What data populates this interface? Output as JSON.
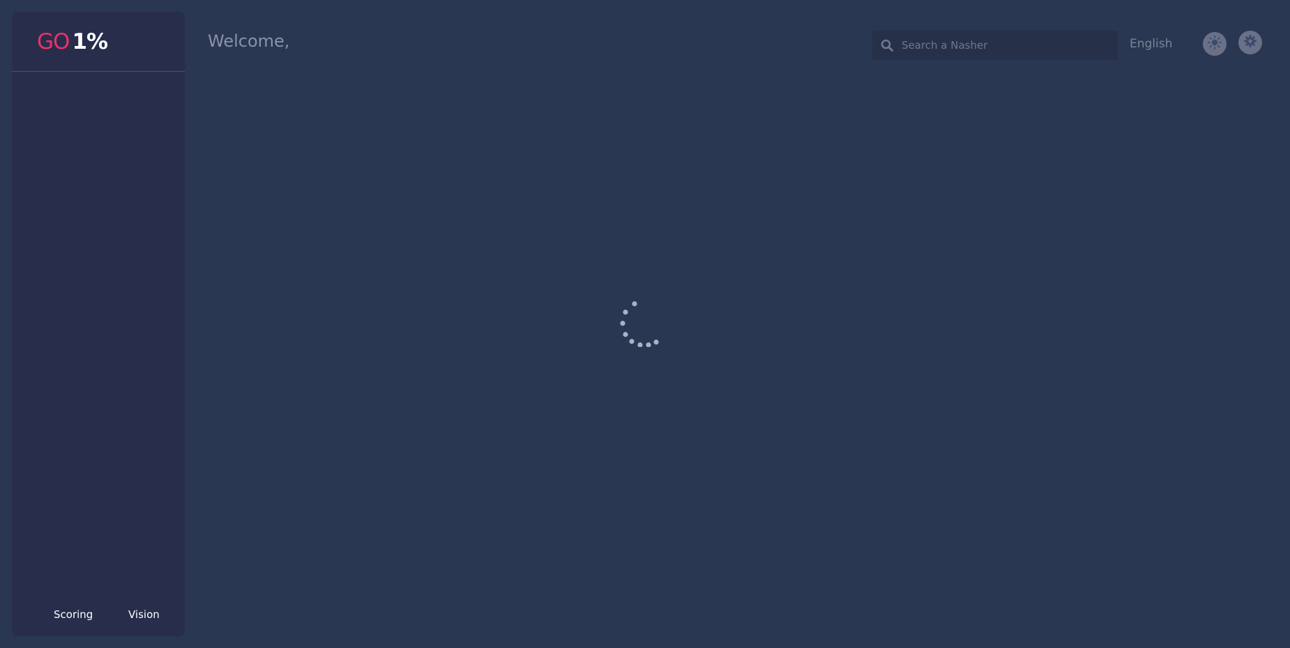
{
  "logo": {
    "part1": "GO",
    "part2": "1%"
  },
  "header": {
    "welcome": "Welcome,"
  },
  "search": {
    "placeholder": "Search a Nasher",
    "value": ""
  },
  "language": {
    "label": "English"
  },
  "sidebar": {
    "footer_links": [
      {
        "label": "Scoring"
      },
      {
        "label": "Vision"
      }
    ]
  },
  "icons": {
    "search": "search-icon",
    "theme": "sun-icon",
    "settings": "gear-icon",
    "loading": "loading-spinner"
  },
  "colors": {
    "background": "#2a3752",
    "sidebar": "#272d4a",
    "brand_accent": "#e8336a"
  }
}
